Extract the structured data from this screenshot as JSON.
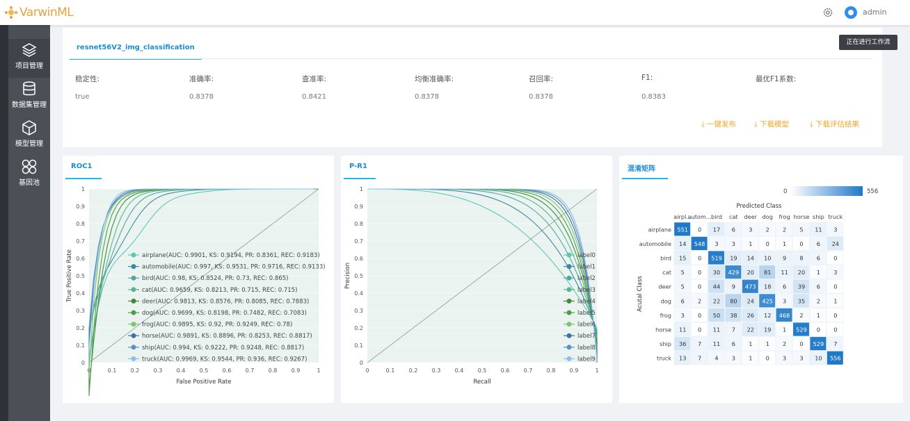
{
  "app": {
    "logo_text": "VarwinML",
    "admin": "admin"
  },
  "sidebar": {
    "items": [
      {
        "label": "项目管理",
        "icon": "layers-icon"
      },
      {
        "label": "数据集管理",
        "icon": "database-icon"
      },
      {
        "label": "模型管理",
        "icon": "cube-icon"
      },
      {
        "label": "基因池",
        "icon": "clover-icon"
      }
    ]
  },
  "tooltip": "正在进行工作流",
  "tab": {
    "label": "resnet56V2_img_classification"
  },
  "metrics": {
    "labels": [
      "稳定性:",
      "准确率:",
      "查准率:",
      "均衡准确率:",
      "召回率:",
      "F1:",
      "最优F1系数:"
    ],
    "values": [
      "true",
      "0.8378",
      "0.8421",
      "0.8378",
      "0.8378",
      "0.8383",
      ""
    ]
  },
  "actions": [
    "一键发布",
    "下载模型",
    "下载评估结果"
  ],
  "panels": {
    "roc": "ROC1",
    "pr": "P-R1",
    "cm": "混淆矩阵"
  },
  "roc": {
    "xlabel": "False Positive Rate",
    "ylabel": "True Positive Rate",
    "ticks": [
      "0",
      "0.1",
      "0.2",
      "0.3",
      "0.4",
      "0.5",
      "0.6",
      "0.7",
      "0.8",
      "0.9",
      "1"
    ],
    "legend": [
      "airplane(AUC: 0.9901, KS: 0.9194, PR: 0.8361, REC: 0.9183)",
      "automobile(AUC: 0.997, KS: 0.9531, PR: 0.9716, REC: 0.9133)",
      "bird(AUC: 0.98, KS: 0.8524, PR: 0.73, REC: 0.865)",
      "cat(AUC: 0.9659, KS: 0.8213, PR: 0.715, REC: 0.715)",
      "deer(AUC: 0.9813, KS: 0.8576, PR: 0.8085, REC: 0.7883)",
      "dog(AUC: 0.9699, KS: 0.8198, PR: 0.7482, REC: 0.7083)",
      "frog(AUC: 0.9895, KS: 0.92, PR: 0.9249, REC: 0.78)",
      "horse(AUC: 0.9891, KS: 0.8896, PR: 0.8253, REC: 0.8817)",
      "ship(AUC: 0.994, KS: 0.9222, PR: 0.9248, REC: 0.8817)",
      "truck(AUC: 0.9969, KS: 0.9544, PR: 0.936, REC: 0.9267)"
    ],
    "colors": [
      "#5fc6b0",
      "#3a8aa0",
      "#4fa8a0",
      "#5ab48c",
      "#3d8a3d",
      "#4aa04a",
      "#7cc66e",
      "#3f6fa6",
      "#5b8fc8",
      "#8cc0e8"
    ]
  },
  "pr": {
    "xlabel": "Recall",
    "ylabel": "Precision",
    "legend": [
      "label0",
      "label1",
      "label2",
      "label3",
      "label4",
      "label5",
      "label6",
      "label7",
      "label8",
      "label9"
    ]
  },
  "cm": {
    "title": "Predicted Class",
    "ylabel": "Acutal Class",
    "scale_min": "0",
    "scale_max": "556",
    "cols": [
      "airpl...",
      "autom...",
      "bird",
      "cat",
      "deer",
      "dog",
      "frog",
      "horse",
      "ship",
      "truck"
    ],
    "rows": [
      "airplane",
      "automobile",
      "bird",
      "cat",
      "deer",
      "dog",
      "frog",
      "horse",
      "ship",
      "truck"
    ],
    "values": [
      [
        551,
        0,
        17,
        6,
        3,
        2,
        2,
        5,
        11,
        3
      ],
      [
        14,
        548,
        3,
        3,
        1,
        0,
        1,
        0,
        6,
        24
      ],
      [
        15,
        0,
        519,
        19,
        14,
        10,
        9,
        8,
        6,
        0
      ],
      [
        5,
        0,
        30,
        429,
        20,
        81,
        11,
        20,
        1,
        3
      ],
      [
        5,
        0,
        44,
        9,
        473,
        18,
        6,
        39,
        6,
        0
      ],
      [
        6,
        2,
        22,
        80,
        24,
        425,
        3,
        35,
        2,
        1
      ],
      [
        3,
        0,
        50,
        38,
        26,
        12,
        468,
        2,
        1,
        0
      ],
      [
        11,
        0,
        11,
        7,
        22,
        19,
        1,
        529,
        0,
        0
      ],
      [
        36,
        7,
        11,
        6,
        1,
        1,
        2,
        0,
        529,
        7
      ],
      [
        13,
        7,
        4,
        3,
        1,
        0,
        3,
        3,
        10,
        556
      ]
    ],
    "max": 556
  }
}
